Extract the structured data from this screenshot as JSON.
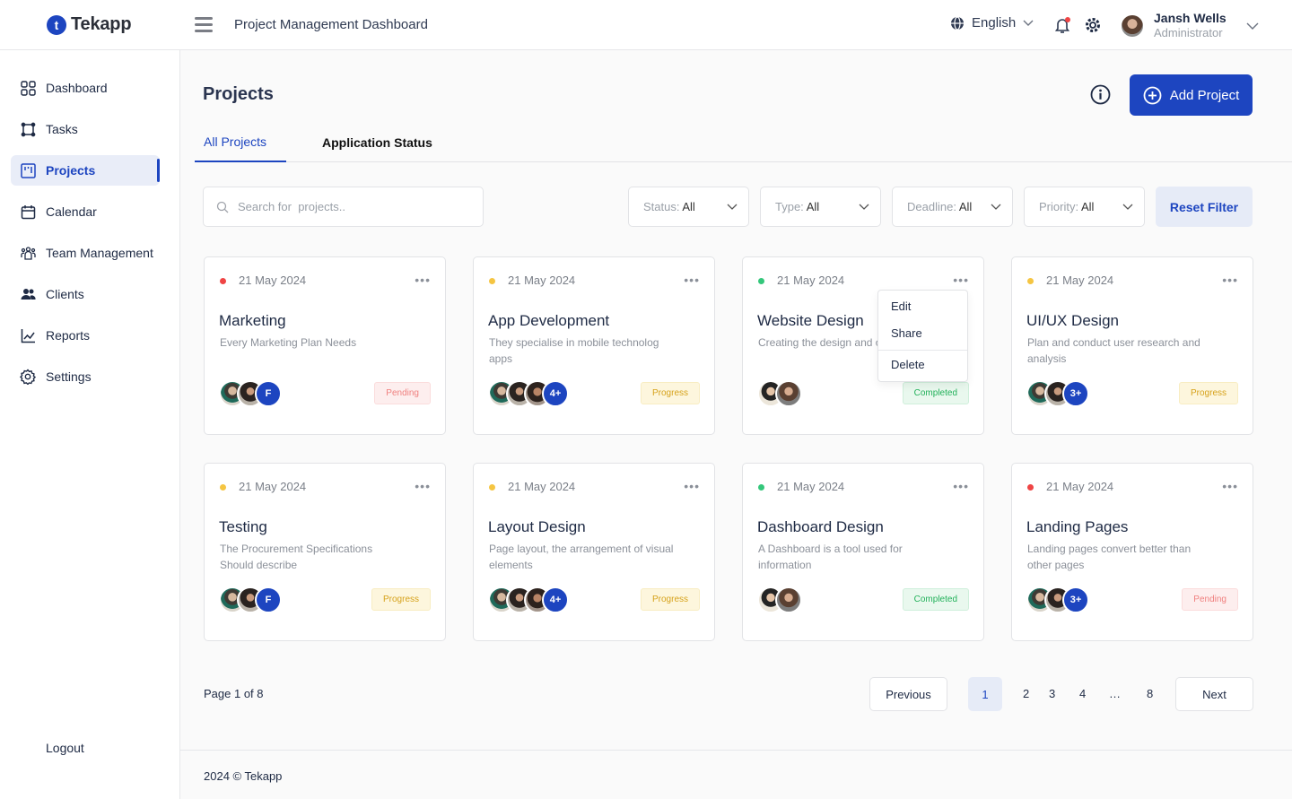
{
  "header": {
    "logo_letter": "t",
    "logo_text": "Tekapp",
    "app_title": "Project Management Dashboard",
    "language": "English",
    "user_name": "Jansh Wells",
    "user_role": "Administrator",
    "notification_dot_color": "#ef4444"
  },
  "sidebar": {
    "items": [
      {
        "label": "Dashboard",
        "icon": "grid-icon"
      },
      {
        "label": "Tasks",
        "icon": "tasks-icon"
      },
      {
        "label": "Projects",
        "icon": "projects-icon",
        "active": true
      },
      {
        "label": "Calendar",
        "icon": "calendar-icon"
      },
      {
        "label": "Team Management",
        "icon": "team-icon"
      },
      {
        "label": "Clients",
        "icon": "clients-icon"
      },
      {
        "label": "Reports",
        "icon": "chart-icon"
      },
      {
        "label": "Settings",
        "icon": "gear-icon"
      }
    ],
    "logout": "Logout"
  },
  "main": {
    "title": "Projects",
    "add_button": "Add Project",
    "tabs": [
      {
        "label": "All Projects",
        "active": true
      },
      {
        "label": "Application Status",
        "active": false
      }
    ],
    "search_placeholder": "Search for  projects..",
    "filters": [
      {
        "key": "Status:",
        "value": "All"
      },
      {
        "key": "Type:",
        "value": "All"
      },
      {
        "key": "Deadline:",
        "value": "All"
      },
      {
        "key": "Priority:",
        "value": "All"
      }
    ],
    "reset_filter": "Reset Filter",
    "colors": {
      "accent": "#1d45c0",
      "pending": "#ef4444",
      "progress": "#f5c542",
      "completed": "#34c77b"
    },
    "cards": [
      {
        "date": "21 May 2024",
        "title": "Marketing",
        "desc": "Every Marketing Plan Needs",
        "status": "Pending",
        "dot": "pending",
        "avatars": [
          "p1",
          "p2"
        ],
        "more": "F"
      },
      {
        "date": "21 May 2024",
        "title": "App Development",
        "desc": "They specialise in mobile technolog apps",
        "status": "Progress",
        "dot": "progress",
        "avatars": [
          "p1",
          "p2",
          "p3"
        ],
        "more": "4+"
      },
      {
        "date": "21 May 2024",
        "title": "Website Design",
        "desc": "Creating the design and of a website",
        "status": "Completed",
        "dot": "completed",
        "avatars": [
          "p4",
          "p5"
        ],
        "more": ""
      },
      {
        "date": "21 May 2024",
        "title": "UI/UX Design",
        "desc": "Plan and conduct user research and analysis",
        "status": "Progress",
        "dot": "progress",
        "avatars": [
          "p1",
          "p2"
        ],
        "more": "3+"
      },
      {
        "date": "21 May 2024",
        "title": "Testing",
        "desc": "The Procurement Specifications Should describe",
        "status": "Progress",
        "dot": "progress",
        "avatars": [
          "p1",
          "p2"
        ],
        "more": "F"
      },
      {
        "date": "21 May 2024",
        "title": "Layout Design",
        "desc": "Page layout, the arrangement of visual elements",
        "status": "Progress",
        "dot": "progress",
        "avatars": [
          "p1",
          "p2",
          "p3"
        ],
        "more": "4+"
      },
      {
        "date": "21 May 2024",
        "title": "Dashboard Design",
        "desc": "A Dashboard is a tool used for information",
        "status": "Completed",
        "dot": "completed",
        "avatars": [
          "p4",
          "p5"
        ],
        "more": ""
      },
      {
        "date": "21 May 2024",
        "title": "Landing Pages",
        "desc": "Landing pages convert better than other pages",
        "status": "Pending",
        "dot": "pending",
        "avatars": [
          "p1",
          "p2"
        ],
        "more": "3+"
      }
    ],
    "context_menu": {
      "items": [
        "Edit",
        "Share",
        "Delete"
      ]
    }
  },
  "pagination": {
    "info": "Page 1 of 8",
    "previous": "Previous",
    "next": "Next",
    "current": "1",
    "pages": [
      "2",
      "3",
      "4",
      "…",
      "8"
    ]
  },
  "footer": {
    "text": "2024 © Tekapp"
  }
}
